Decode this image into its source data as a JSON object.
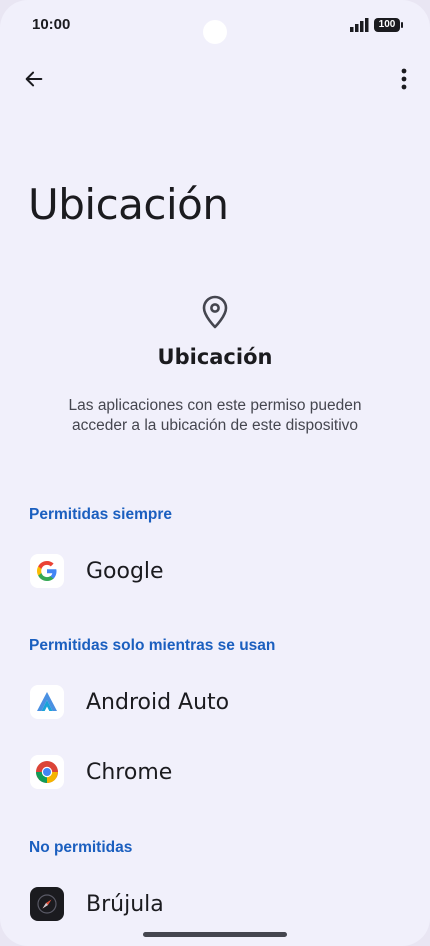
{
  "status_bar": {
    "time": "10:00",
    "battery": "100"
  },
  "toolbar": {
    "back_icon": "arrow-back-icon",
    "menu_icon": "more-vert-icon"
  },
  "page": {
    "title": "Ubicación",
    "header_icon": "location-pin-icon",
    "heading": "Ubicación",
    "description": "Las aplicaciones con este permiso pueden acceder a la ubicación de este dispositivo"
  },
  "sections": [
    {
      "label": "Permitidas siempre",
      "apps": [
        {
          "name": "Google",
          "icon": "google-icon"
        }
      ]
    },
    {
      "label": "Permitidas solo mientras se usan",
      "apps": [
        {
          "name": "Android Auto",
          "icon": "android-auto-icon"
        },
        {
          "name": "Chrome",
          "icon": "chrome-icon"
        }
      ]
    },
    {
      "label": "No permitidas",
      "apps": [
        {
          "name": "Brújula",
          "icon": "compass-icon"
        }
      ]
    }
  ],
  "colors": {
    "background": "#f1f0fb",
    "section_label": "#1b5fbf",
    "text": "#1b1b1f"
  }
}
